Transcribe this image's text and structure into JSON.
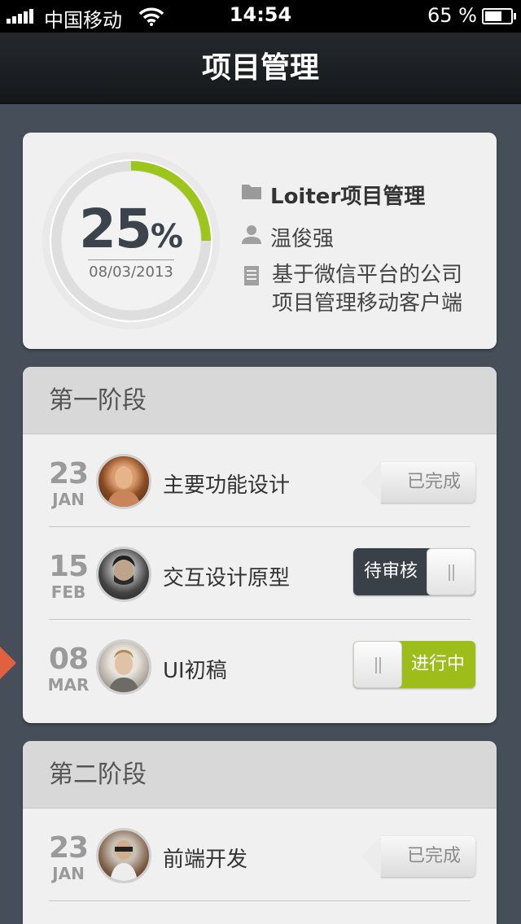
{
  "status_bar": {
    "carrier": "中国移动",
    "time": "14:54",
    "battery_text": "65 %",
    "battery_level": 0.65
  },
  "nav": {
    "title": "项目管理"
  },
  "summary": {
    "progress_text": "25",
    "progress_unit": "%",
    "progress_value": 0.25,
    "date": "08/03/2013",
    "project_name": "Loiter项目管理",
    "owner": "温俊强",
    "description": "基于微信平台的公司项目管理移动客户端",
    "colors": {
      "ring_accent": "#9cc61b",
      "ring_track": "#dedede"
    }
  },
  "phases": [
    {
      "title": "第一阶段",
      "tasks": [
        {
          "day": "23",
          "month": "JAN",
          "name": "主要功能设计",
          "status": "已完成",
          "status_type": "done"
        },
        {
          "day": "15",
          "month": "FEB",
          "name": "交互设计原型",
          "status": "待审核",
          "status_type": "review"
        },
        {
          "day": "08",
          "month": "MAR",
          "name": "UI初稿",
          "status": "进行中",
          "status_type": "in-progress"
        }
      ]
    },
    {
      "title": "第二阶段",
      "tasks": [
        {
          "day": "23",
          "month": "JAN",
          "name": "前端开发",
          "status": "已完成",
          "status_type": "done"
        }
      ]
    }
  ],
  "icons": [
    "signal-icon",
    "wifi-icon",
    "battery-icon",
    "folder-icon",
    "user-icon",
    "document-icon"
  ],
  "accent_colors": {
    "progress_green": "#9cbd1a",
    "review_dark": "#3a4048",
    "current_marker": "#e06040"
  }
}
